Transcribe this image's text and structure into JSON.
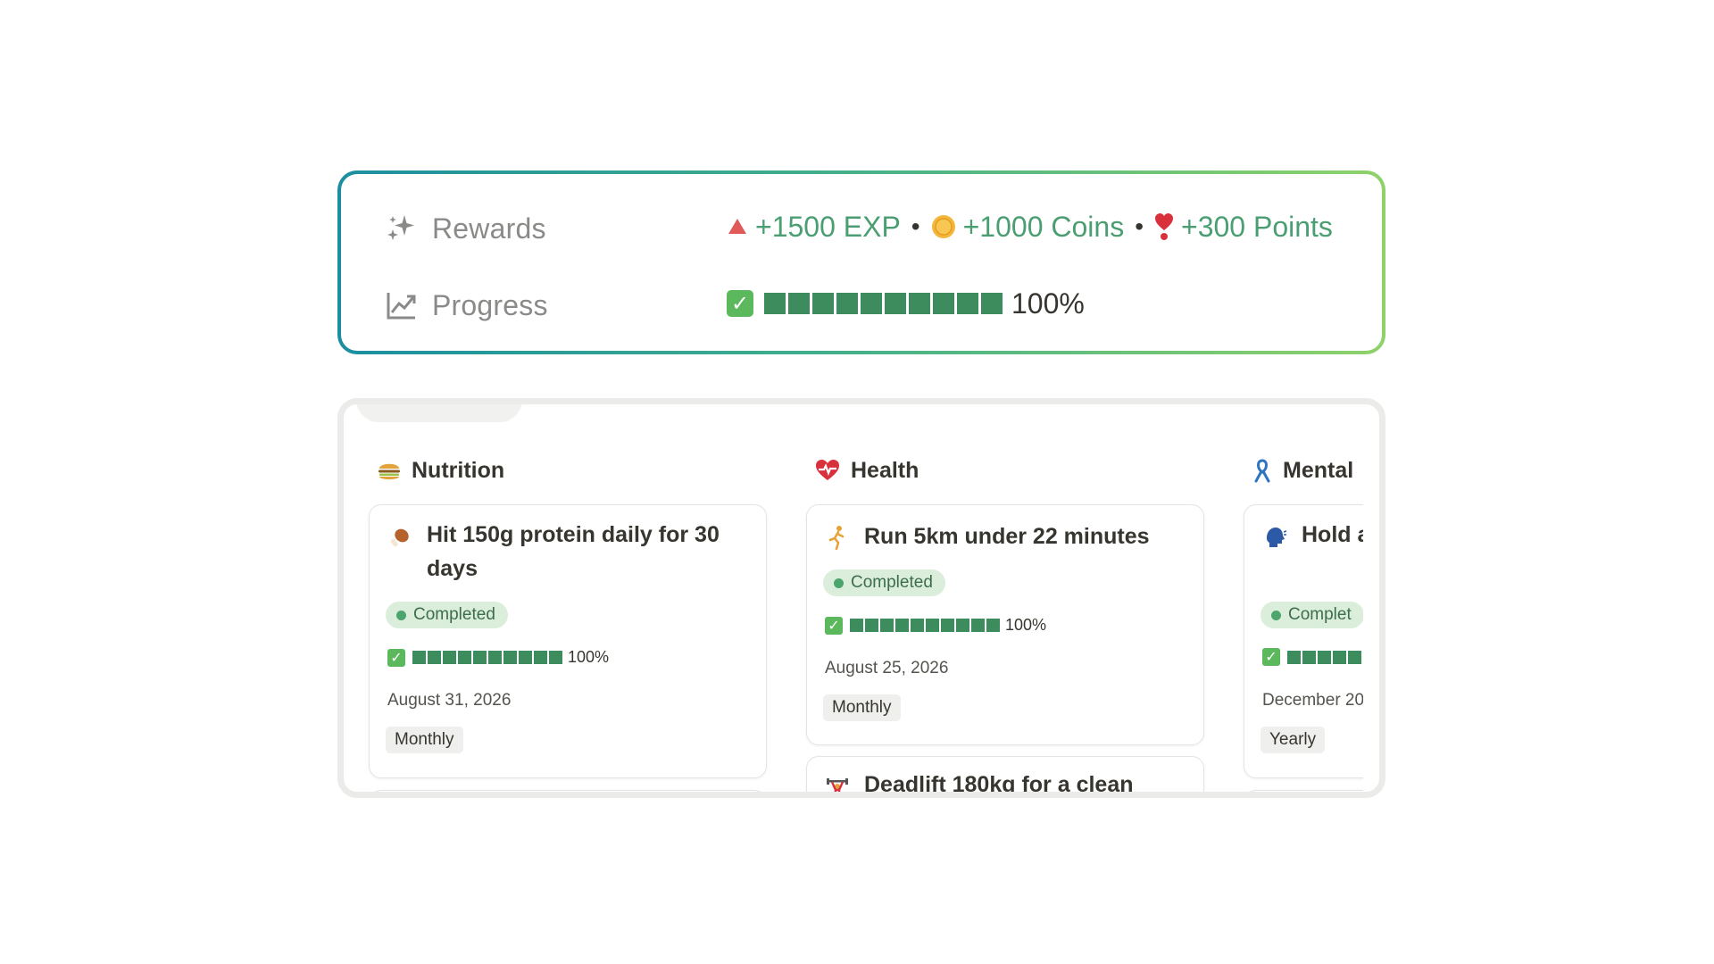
{
  "properties": {
    "rewards_label": "Rewards",
    "progress_label": "Progress",
    "rewards": {
      "exp": "+1500 EXP",
      "coins": "+1000 Coins",
      "points": "+300 Points",
      "separator": "•"
    },
    "progress": {
      "percent_text": "100%",
      "fraction": 1.0
    }
  },
  "columns": [
    {
      "title": "Nutrition",
      "icon": "burger-icon",
      "cards": [
        {
          "icon": "drumstick-icon",
          "title": "Hit 150g protein daily for 30 days",
          "status": "Completed",
          "progress_text": "100%",
          "date": "August 31, 2026",
          "tag": "Monthly"
        }
      ]
    },
    {
      "title": "Health",
      "icon": "heart-pulse-icon",
      "cards": [
        {
          "icon": "runner-icon",
          "title": "Run 5km under 22 minutes",
          "status": "Completed",
          "progress_text": "100%",
          "date": "August 25, 2026",
          "tag": "Monthly"
        },
        {
          "icon": "weightlifter-icon",
          "title": "Deadlift 180kg for a clean"
        }
      ]
    },
    {
      "title": "Mental",
      "icon": "ribbon-icon",
      "cards": [
        {
          "icon": "speaking-head-icon",
          "title": "Hold a conve",
          "status": "Complet",
          "progress_text": "",
          "date": "December 20",
          "tag": "Yearly"
        }
      ]
    }
  ],
  "colors": {
    "accent_green": "#4a9e72",
    "progress_square": "#3d8c5e",
    "status_bg": "#dbeddb",
    "gradient_start": "#1b8fa0",
    "gradient_end": "#8fd26a"
  }
}
